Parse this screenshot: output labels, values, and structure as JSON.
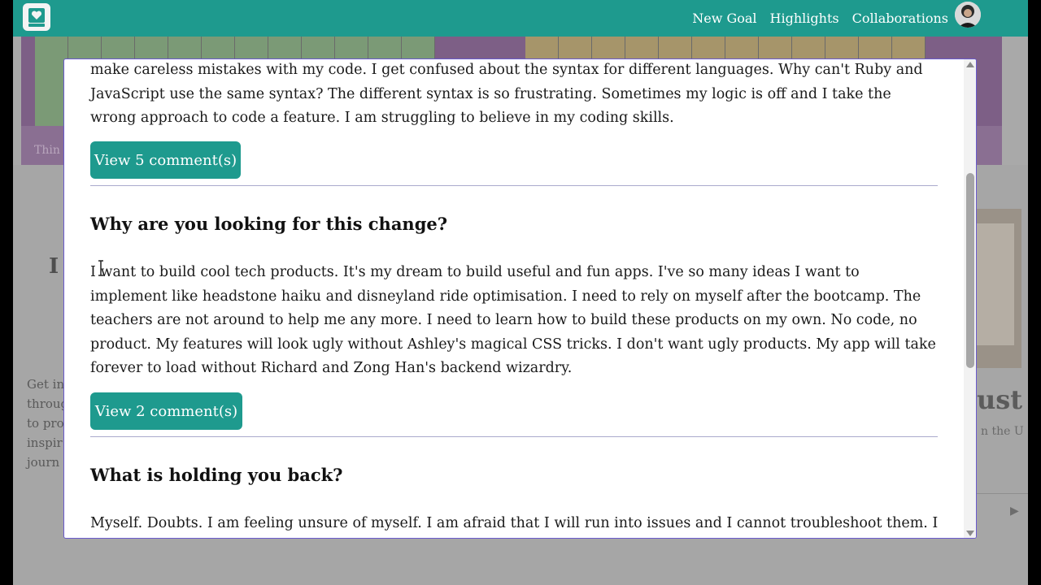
{
  "nav": {
    "links": [
      "New Goal",
      "Highlights",
      "Collaborations"
    ],
    "logo_icon": "journal-heart-icon",
    "brand_color": "#1e9a8e"
  },
  "background": {
    "band_label": "Thin",
    "left_heading_fragment": "I",
    "left_text_lines": [
      "Get in",
      "throug",
      "to pro",
      "inspir",
      "journ"
    ],
    "right_word_fragment": "ust",
    "right_sub_fragment": "n the U"
  },
  "modal": {
    "entries": [
      {
        "answer": "make careless mistakes with my code. I get confused about the syntax for different languages. Why can't Ruby and JavaScript use the same syntax? The different syntax is so frustrating. Sometimes my logic is off and I take the wrong approach to code a feature. I am struggling to believe in my coding skills.",
        "comments_label": "View 5 comment(s)"
      },
      {
        "question": "Why are you looking for this change?",
        "answer": "I want to build cool tech products. It's my dream to build useful and fun apps. I've so many ideas I want to implement like headstone haiku and disneyland ride optimisation. I need to rely on myself after the bootcamp. The teachers are not around to help me any more. I need to learn how to build these products on my own. No code, no product. My features will look ugly without Ashley's magical CSS tricks. I don't want ugly products. My app will take forever to load without Richard and Zong Han's backend wizardry.",
        "comments_label": "View 2 comment(s)"
      },
      {
        "question": "What is holding you back?",
        "answer": "Myself. Doubts. I am feeling unsure of myself. I am afraid that I will run into issues and I cannot troubleshoot them. I"
      }
    ]
  }
}
